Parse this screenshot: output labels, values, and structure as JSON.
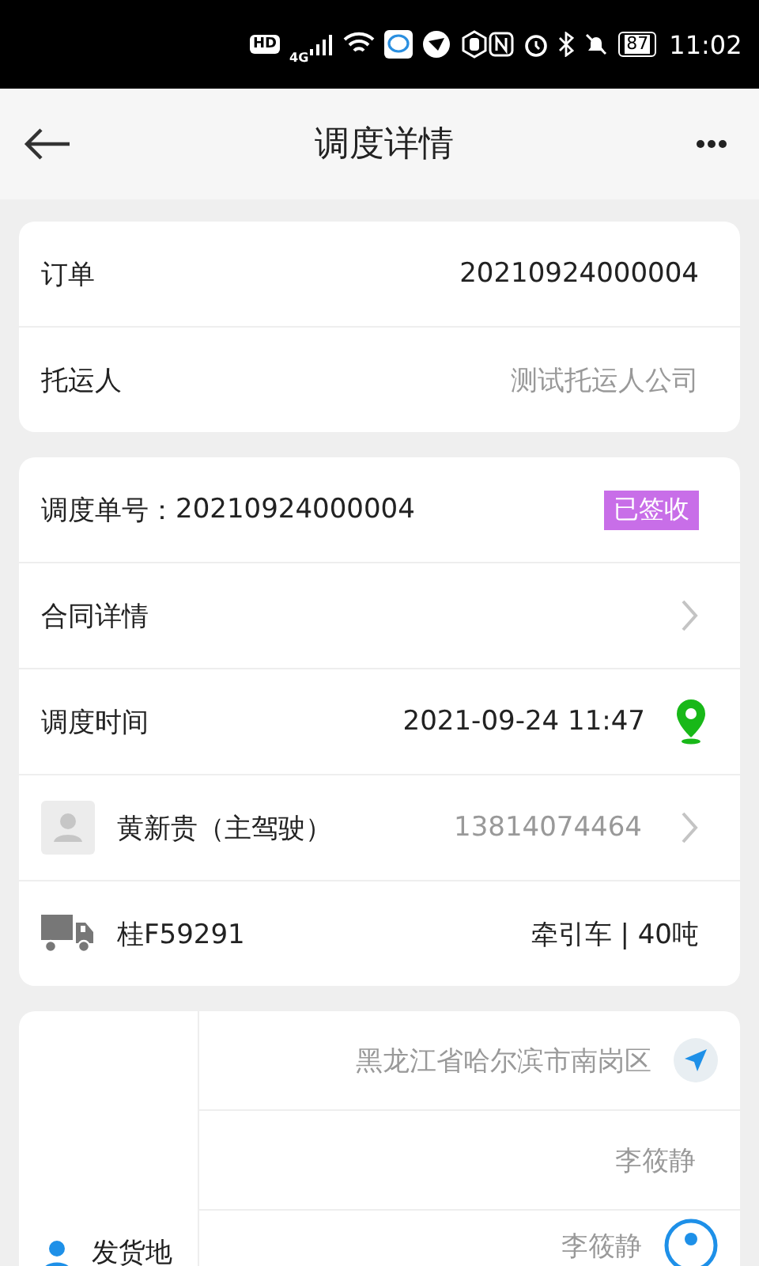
{
  "status_bar": {
    "hd": "HD",
    "network": "4G",
    "battery": "87",
    "time": "11:02"
  },
  "header": {
    "title": "调度详情"
  },
  "order_card": {
    "rows": [
      {
        "label": "订单",
        "value": "20210924000004",
        "kind": "dark"
      },
      {
        "label": "托运人",
        "value": "测试托运人公司",
        "kind": "muted"
      }
    ]
  },
  "dispatch_card": {
    "number_label": "调度单号：",
    "number": "20210924000004",
    "status": "已签收",
    "contract_label": "合同详情",
    "time_label": "调度时间",
    "time": "2021-09-24 11:47",
    "driver": {
      "name": "黄新贵（主驾驶）",
      "phone": "13814074464"
    },
    "vehicle": {
      "plate": "桂F59291",
      "type": "牵引车 | 40吨"
    }
  },
  "shipping_card": {
    "label": "发货地",
    "address": "黑龙江省哈尔滨市南岗区",
    "contact": "李筱静",
    "contact_2": "李筱静"
  }
}
